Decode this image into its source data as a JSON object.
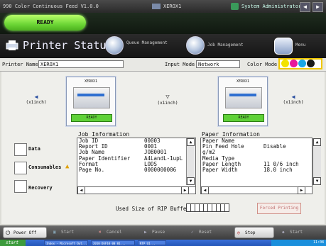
{
  "window": {
    "title": "990 Color Continuous Feed  V1.0.0",
    "host": "XEROX1",
    "user": "System Administrator"
  },
  "status": {
    "ready_label": "READY"
  },
  "header": {
    "title": "Printer Status",
    "queue_label": "Queue Management",
    "job_label": "Job Management",
    "menu_label": "Menu"
  },
  "info": {
    "printer_name_label": "Printer Name",
    "printer_name_value": "XEROX1",
    "input_mode_label": "Input Mode",
    "input_mode_value": "Network",
    "color_mode_label": "Color Mode",
    "color_swatches": [
      "#f2e300",
      "#e8189a",
      "#1aa7e6",
      "#1a1a1a"
    ]
  },
  "printers": {
    "left_label": "(x1inch)",
    "mid_label": "(x1inch)",
    "right_label": "(x1inch)",
    "card1": {
      "name": "XEROX1",
      "status": "READY"
    },
    "card2": {
      "name": "XEROX1",
      "status": "READY"
    }
  },
  "sidebar": {
    "items": [
      {
        "label": "Data"
      },
      {
        "label": "Consumables"
      },
      {
        "label": "Recovery"
      }
    ]
  },
  "job_info": {
    "title": "Job Information",
    "rows": [
      {
        "k": "Job ID",
        "v": "00003"
      },
      {
        "k": "Report ID",
        "v": "0001"
      },
      {
        "k": "Job Name",
        "v": "JOB0001"
      },
      {
        "k": "Paper Identifier",
        "v": "A4LandL-1upL"
      },
      {
        "k": "Format",
        "v": "LODS"
      },
      {
        "k": "Page No.",
        "v": "0000000006"
      }
    ]
  },
  "paper_info": {
    "title": "Paper Information",
    "rows": [
      {
        "k": "Paper Name",
        "v": ""
      },
      {
        "k": "Pin Feed Hole",
        "v": "Disable"
      },
      {
        "k": "g/m2",
        "v": ""
      },
      {
        "k": "Media Type",
        "v": ""
      },
      {
        "k": "Paper Length",
        "v": "11 0/6 inch"
      },
      {
        "k": "Paper Width",
        "v": "18.0 inch"
      }
    ]
  },
  "rip": {
    "label": "Used Size of RIP Buffer",
    "forced_label": "Forced Printing"
  },
  "toolbar": {
    "power_off": "Power Off",
    "start": "Start",
    "cancel": "Cancel",
    "pause": "Pause",
    "reset": "Reset",
    "stop": "Stop",
    "start2": "Start"
  },
  "taskbar": {
    "start": "start",
    "tasks": [
      "Inbox - Microsoft Out...",
      "2010_DEF10_00_01...",
      "RTP UI..."
    ],
    "clock": "11:08"
  }
}
